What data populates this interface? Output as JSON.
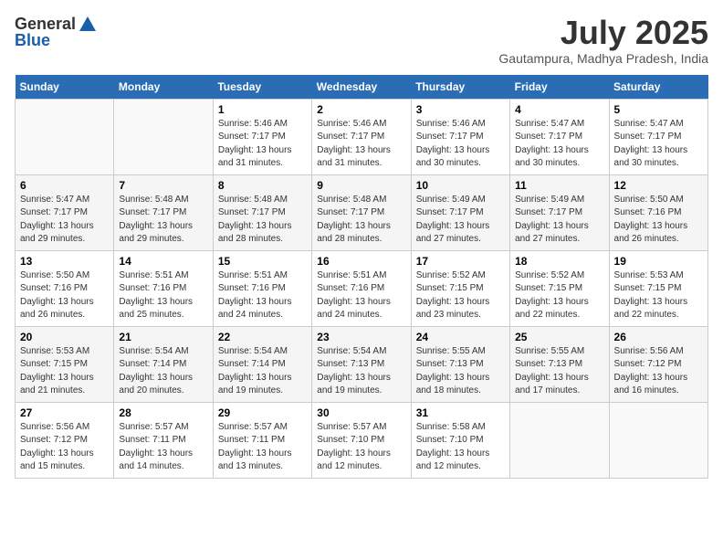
{
  "header": {
    "logo_line1": "General",
    "logo_line2": "Blue",
    "month": "July 2025",
    "location": "Gautampura, Madhya Pradesh, India"
  },
  "weekdays": [
    "Sunday",
    "Monday",
    "Tuesday",
    "Wednesday",
    "Thursday",
    "Friday",
    "Saturday"
  ],
  "weeks": [
    [
      {
        "day": "",
        "info": ""
      },
      {
        "day": "",
        "info": ""
      },
      {
        "day": "1",
        "info": "Sunrise: 5:46 AM\nSunset: 7:17 PM\nDaylight: 13 hours and 31 minutes."
      },
      {
        "day": "2",
        "info": "Sunrise: 5:46 AM\nSunset: 7:17 PM\nDaylight: 13 hours and 31 minutes."
      },
      {
        "day": "3",
        "info": "Sunrise: 5:46 AM\nSunset: 7:17 PM\nDaylight: 13 hours and 30 minutes."
      },
      {
        "day": "4",
        "info": "Sunrise: 5:47 AM\nSunset: 7:17 PM\nDaylight: 13 hours and 30 minutes."
      },
      {
        "day": "5",
        "info": "Sunrise: 5:47 AM\nSunset: 7:17 PM\nDaylight: 13 hours and 30 minutes."
      }
    ],
    [
      {
        "day": "6",
        "info": "Sunrise: 5:47 AM\nSunset: 7:17 PM\nDaylight: 13 hours and 29 minutes."
      },
      {
        "day": "7",
        "info": "Sunrise: 5:48 AM\nSunset: 7:17 PM\nDaylight: 13 hours and 29 minutes."
      },
      {
        "day": "8",
        "info": "Sunrise: 5:48 AM\nSunset: 7:17 PM\nDaylight: 13 hours and 28 minutes."
      },
      {
        "day": "9",
        "info": "Sunrise: 5:48 AM\nSunset: 7:17 PM\nDaylight: 13 hours and 28 minutes."
      },
      {
        "day": "10",
        "info": "Sunrise: 5:49 AM\nSunset: 7:17 PM\nDaylight: 13 hours and 27 minutes."
      },
      {
        "day": "11",
        "info": "Sunrise: 5:49 AM\nSunset: 7:17 PM\nDaylight: 13 hours and 27 minutes."
      },
      {
        "day": "12",
        "info": "Sunrise: 5:50 AM\nSunset: 7:16 PM\nDaylight: 13 hours and 26 minutes."
      }
    ],
    [
      {
        "day": "13",
        "info": "Sunrise: 5:50 AM\nSunset: 7:16 PM\nDaylight: 13 hours and 26 minutes."
      },
      {
        "day": "14",
        "info": "Sunrise: 5:51 AM\nSunset: 7:16 PM\nDaylight: 13 hours and 25 minutes."
      },
      {
        "day": "15",
        "info": "Sunrise: 5:51 AM\nSunset: 7:16 PM\nDaylight: 13 hours and 24 minutes."
      },
      {
        "day": "16",
        "info": "Sunrise: 5:51 AM\nSunset: 7:16 PM\nDaylight: 13 hours and 24 minutes."
      },
      {
        "day": "17",
        "info": "Sunrise: 5:52 AM\nSunset: 7:15 PM\nDaylight: 13 hours and 23 minutes."
      },
      {
        "day": "18",
        "info": "Sunrise: 5:52 AM\nSunset: 7:15 PM\nDaylight: 13 hours and 22 minutes."
      },
      {
        "day": "19",
        "info": "Sunrise: 5:53 AM\nSunset: 7:15 PM\nDaylight: 13 hours and 22 minutes."
      }
    ],
    [
      {
        "day": "20",
        "info": "Sunrise: 5:53 AM\nSunset: 7:15 PM\nDaylight: 13 hours and 21 minutes."
      },
      {
        "day": "21",
        "info": "Sunrise: 5:54 AM\nSunset: 7:14 PM\nDaylight: 13 hours and 20 minutes."
      },
      {
        "day": "22",
        "info": "Sunrise: 5:54 AM\nSunset: 7:14 PM\nDaylight: 13 hours and 19 minutes."
      },
      {
        "day": "23",
        "info": "Sunrise: 5:54 AM\nSunset: 7:13 PM\nDaylight: 13 hours and 19 minutes."
      },
      {
        "day": "24",
        "info": "Sunrise: 5:55 AM\nSunset: 7:13 PM\nDaylight: 13 hours and 18 minutes."
      },
      {
        "day": "25",
        "info": "Sunrise: 5:55 AM\nSunset: 7:13 PM\nDaylight: 13 hours and 17 minutes."
      },
      {
        "day": "26",
        "info": "Sunrise: 5:56 AM\nSunset: 7:12 PM\nDaylight: 13 hours and 16 minutes."
      }
    ],
    [
      {
        "day": "27",
        "info": "Sunrise: 5:56 AM\nSunset: 7:12 PM\nDaylight: 13 hours and 15 minutes."
      },
      {
        "day": "28",
        "info": "Sunrise: 5:57 AM\nSunset: 7:11 PM\nDaylight: 13 hours and 14 minutes."
      },
      {
        "day": "29",
        "info": "Sunrise: 5:57 AM\nSunset: 7:11 PM\nDaylight: 13 hours and 13 minutes."
      },
      {
        "day": "30",
        "info": "Sunrise: 5:57 AM\nSunset: 7:10 PM\nDaylight: 13 hours and 12 minutes."
      },
      {
        "day": "31",
        "info": "Sunrise: 5:58 AM\nSunset: 7:10 PM\nDaylight: 13 hours and 12 minutes."
      },
      {
        "day": "",
        "info": ""
      },
      {
        "day": "",
        "info": ""
      }
    ]
  ]
}
